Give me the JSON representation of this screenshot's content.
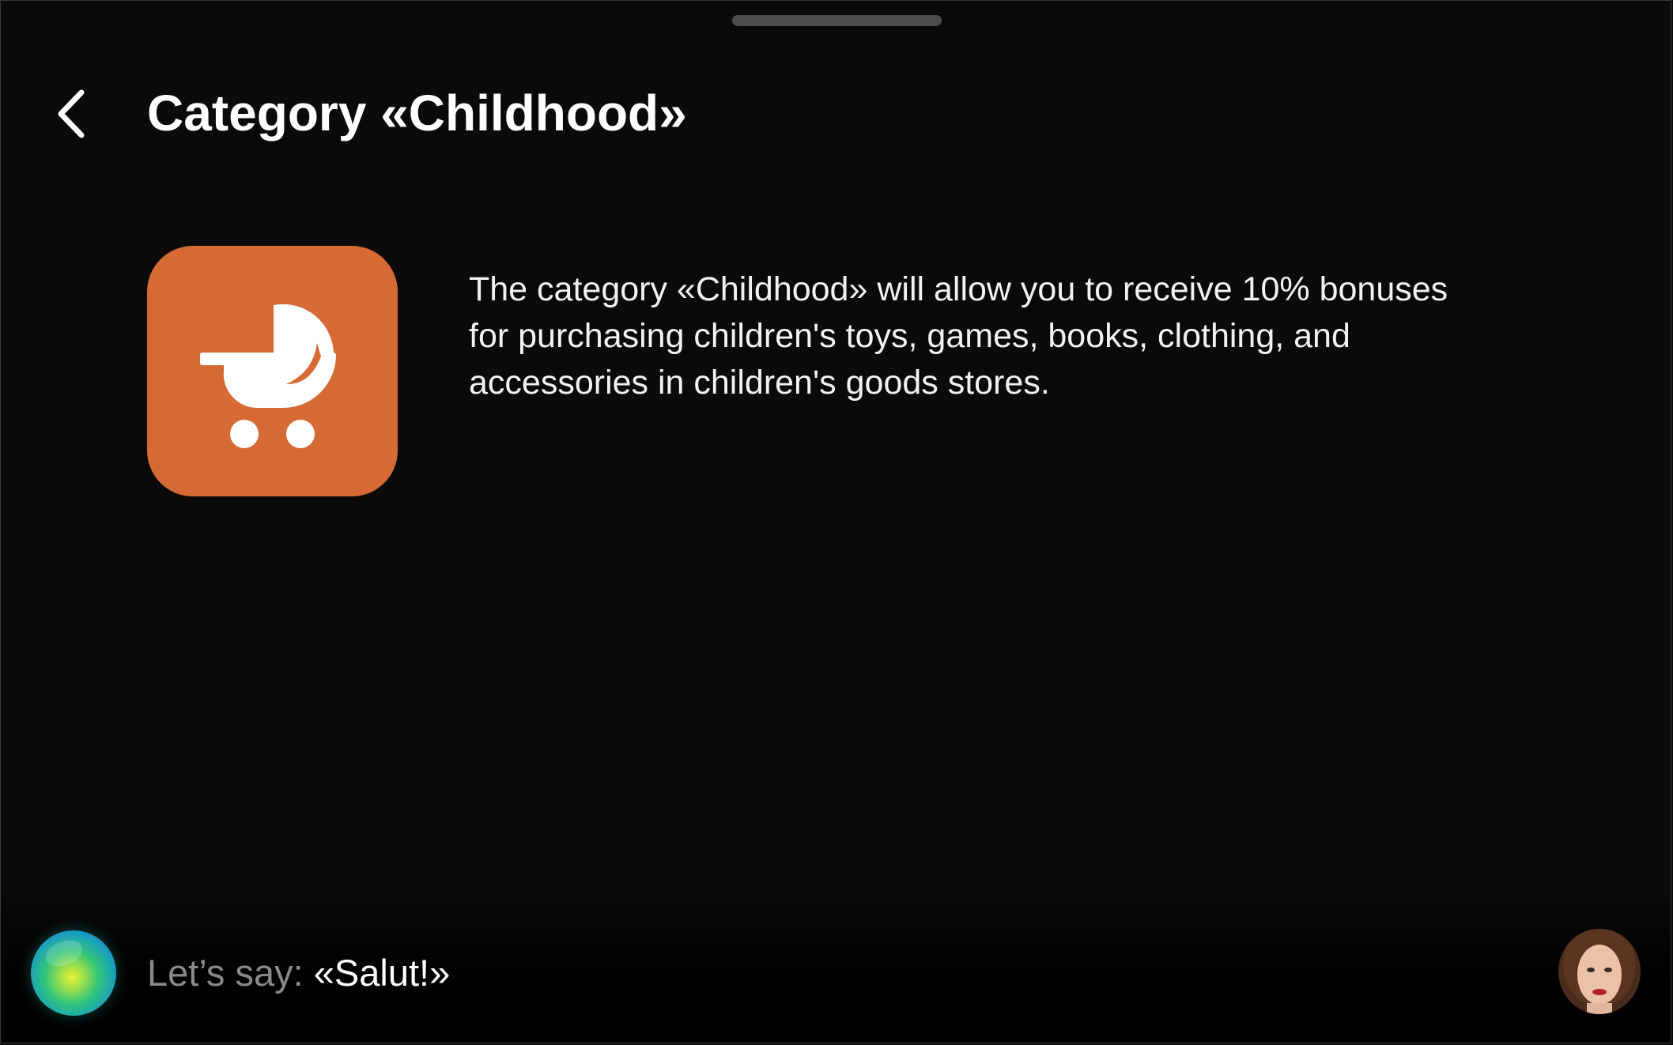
{
  "header": {
    "back_icon": "chevron-left-icon",
    "title": "Category «Childhood»"
  },
  "category": {
    "icon": "baby-stroller-icon",
    "tile_color": "#d56a35",
    "description": "The category «Childhood» will allow you to receive 10% bonuses for purchasing children's toys, games, books, clothing, and accessories in children's goods stores."
  },
  "footer": {
    "assistant_icon": "assistant-orb-icon",
    "hint_prefix": "Let’s say: ",
    "hint_phrase": "«Salut!»",
    "avatar_icon": "user-avatar"
  },
  "colors": {
    "background": "#0a0a0a",
    "text_primary": "#ffffff",
    "text_secondary": "#8a8a8a",
    "accent": "#d56a35"
  }
}
